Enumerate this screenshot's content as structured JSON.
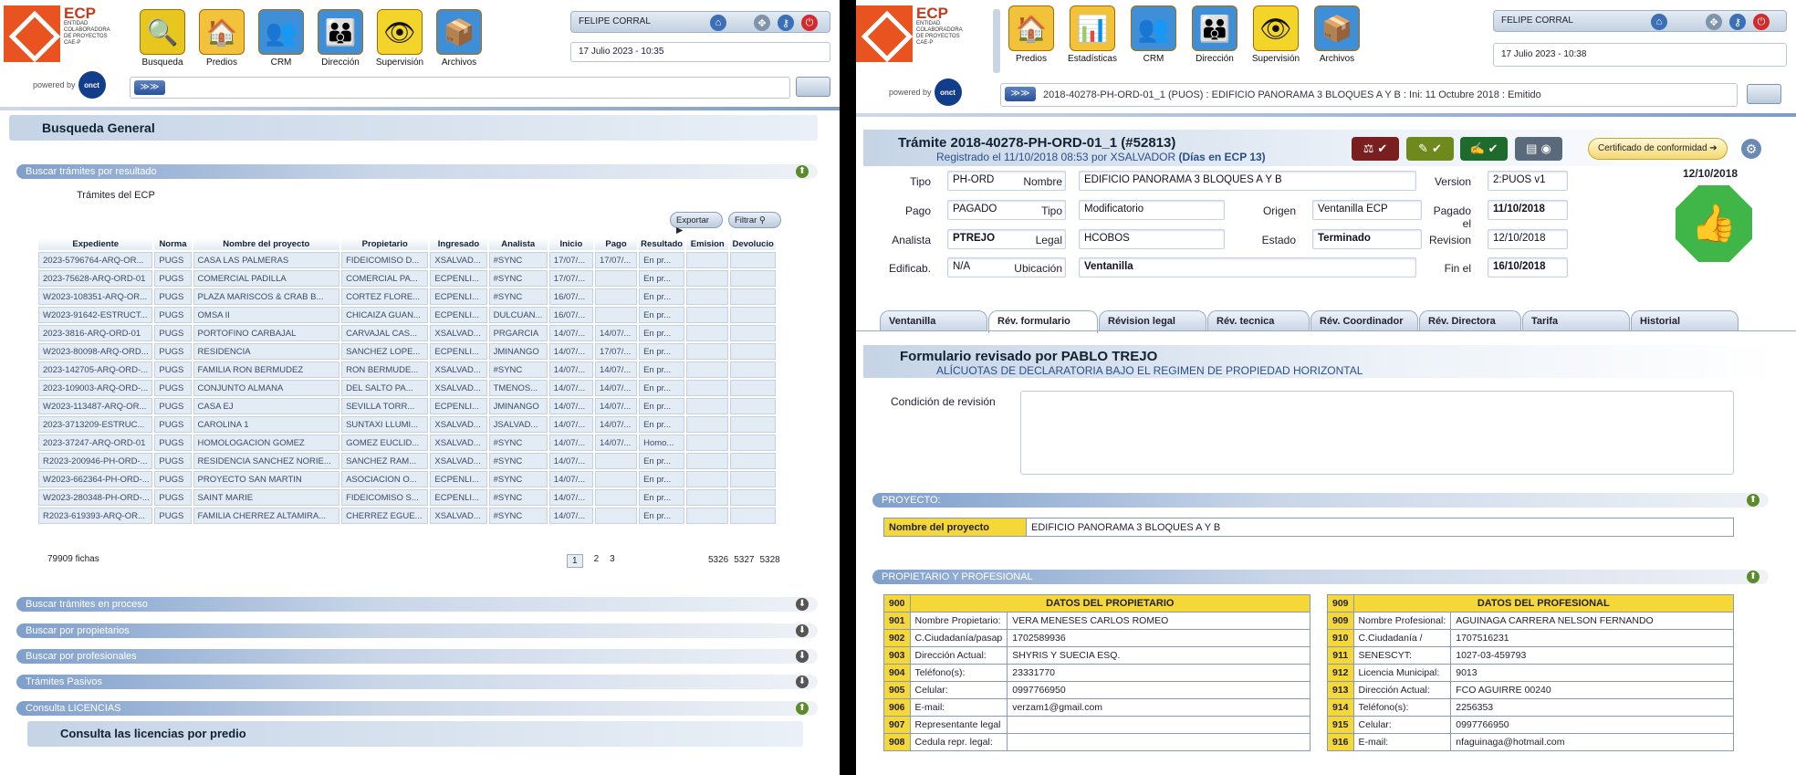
{
  "left": {
    "logo": {
      "title": "ECP",
      "sub1": "ENTIDAD",
      "sub2": "COLABORADORA",
      "sub3": "DE PROYECTOS",
      "sub4": "CAE-P",
      "powered": "powered by",
      "onct": "onct"
    },
    "nav": [
      {
        "label": "Busqueda",
        "icon": "search-icon"
      },
      {
        "label": "Predios",
        "icon": "house-icon"
      },
      {
        "label": "CRM",
        "icon": "people-icon"
      },
      {
        "label": "Dirección",
        "icon": "org-icon"
      },
      {
        "label": "Supervisión",
        "icon": "eye-icon"
      },
      {
        "label": "Archivos",
        "icon": "box-icon"
      }
    ],
    "user": "FELIPE CORRAL",
    "date": "17 Julio 2023 - 10:35",
    "crumb_arrows": "≫≫",
    "page_title": "Busqueda General",
    "sections": {
      "resultado": "Buscar trámites por resultado",
      "proceso": "Buscar trámites en proceso",
      "propietarios": "Buscar por propietarios",
      "profesionales": "Buscar por profesionales",
      "pasivos": "Trámites Pasivos",
      "licencias": "Consulta LICENCIAS"
    },
    "tramites_title": "Trámites del ECP",
    "export_label": "Exportar",
    "filter_label": "Filtrar",
    "columns": [
      "Expediente",
      "Norma",
      "Nombre del proyecto",
      "Propietario",
      "Ingresado",
      "Analista",
      "Inicio",
      "Pago",
      "Resultado",
      "Emision",
      "Devolucio"
    ],
    "rows": [
      [
        "2023-5796764-ARQ-OR...",
        "PUGS",
        "CASA LAS PALMERAS",
        "FIDEICOMISO D...",
        "XSALVAD...",
        "#SYNC",
        "17/07/...",
        "17/07/...",
        "En pr...",
        "",
        ""
      ],
      [
        "2023-75628-ARQ-ORD-01",
        "PUGS",
        "COMERCIAL PADILLA",
        "COMERCIAL PA...",
        "ECPENLI...",
        "#SYNC",
        "17/07/...",
        "",
        "En pr...",
        "",
        ""
      ],
      [
        "W2023-108351-ARQ-OR...",
        "PUGS",
        "PLAZA MARISCOS & CRAB B...",
        "CORTEZ FLORE...",
        "ECPENLI...",
        "#SYNC",
        "16/07/...",
        "",
        "En pr...",
        "",
        ""
      ],
      [
        "W2023-91642-ESTRUCT...",
        "PUGS",
        "OMSA II",
        "CHICAIZA GUAN...",
        "ECPENLI...",
        "DULCUAN...",
        "16/07/...",
        "",
        "En pr...",
        "",
        ""
      ],
      [
        "2023-3816-ARQ-ORD-01",
        "PUGS",
        "PORTOFINO CARBAJAL",
        "CARVAJAL CAS...",
        "XSALVAD...",
        "PRGARCIA",
        "14/07/...",
        "14/07/...",
        "En pr...",
        "",
        ""
      ],
      [
        "W2023-80098-ARQ-ORD...",
        "PUGS",
        "RESIDENCIA",
        "SANCHEZ LOPE...",
        "ECPENLI...",
        "JMINANGO",
        "14/07/...",
        "17/07/...",
        "En pr...",
        "",
        ""
      ],
      [
        "2023-142705-ARQ-ORD-...",
        "PUGS",
        "FAMILIA RON BERMUDEZ",
        "RON BERMUDE...",
        "XSALVAD...",
        "#SYNC",
        "14/07/...",
        "14/07/...",
        "En pr...",
        "",
        ""
      ],
      [
        "2023-109003-ARQ-ORD-...",
        "PUGS",
        "CONJUNTO ALMANA",
        "DEL SALTO PA...",
        "XSALVAD...",
        "TMENOS...",
        "14/07/...",
        "14/07/...",
        "En pr...",
        "",
        ""
      ],
      [
        "W2023-113487-ARQ-OR...",
        "PUGS",
        "CASA EJ",
        "SEVILLA TORR...",
        "ECPENLI...",
        "JMINANGO",
        "14/07/...",
        "14/07/...",
        "En pr...",
        "",
        ""
      ],
      [
        "2023-3713209-ESTRUC...",
        "PUGS",
        "CAROLINA 1",
        "SUNTAXI LLUMI...",
        "XSALVAD...",
        "JSALVAD...",
        "14/07/...",
        "14/07/...",
        "En pr...",
        "",
        ""
      ],
      [
        "2023-37247-ARQ-ORD-01",
        "PUGS",
        "HOMOLOGACION GOMEZ",
        "GOMEZ EUCLID...",
        "XSALVAD...",
        "#SYNC",
        "14/07/...",
        "14/07/...",
        "Homo...",
        "",
        ""
      ],
      [
        "R2023-200946-PH-ORD-...",
        "PUGS",
        "RESIDENCIA SANCHEZ NORIE...",
        "SANCHEZ RAM...",
        "XSALVAD...",
        "#SYNC",
        "14/07/...",
        "",
        "En pr...",
        "",
        ""
      ],
      [
        "W2023-662364-PH-ORD-...",
        "PUGS",
        "PROYECTO SAN MARTIN",
        "ASOCIACION O...",
        "ECPENLI...",
        "#SYNC",
        "14/07/...",
        "",
        "En pr...",
        "",
        ""
      ],
      [
        "W2023-280348-PH-ORD-...",
        "PUGS",
        "SAINT MARIE",
        "FIDEICOMISO S...",
        "ECPENLI...",
        "#SYNC",
        "14/07/...",
        "",
        "En pr...",
        "",
        ""
      ],
      [
        "R2023-619393-ARQ-OR...",
        "PUGS",
        "FAMILIA CHERREZ ALTAMIRA...",
        "CHERREZ EGUE...",
        "XSALVAD...",
        "#SYNC",
        "14/07/...",
        "",
        "En pr...",
        "",
        ""
      ]
    ],
    "fichas": "79909 fichas",
    "pages": [
      "1",
      "2",
      "3"
    ],
    "pages_last": [
      "5326",
      "5327",
      "5328"
    ],
    "licencias_sub": "Consulta las licencias por predio"
  },
  "right": {
    "nav": [
      {
        "label": "Predios",
        "icon": "house-icon"
      },
      {
        "label": "Estadísticas",
        "icon": "stats-icon"
      },
      {
        "label": "CRM",
        "icon": "people-icon"
      },
      {
        "label": "Dirección",
        "icon": "org-icon"
      },
      {
        "label": "Supervisión",
        "icon": "eye-icon"
      },
      {
        "label": "Archivos",
        "icon": "box-icon"
      }
    ],
    "user": "FELIPE CORRAL",
    "date": "17 Julio 2023 - 10:38",
    "crumb": "2018-40278-PH-ORD-01_1 (PUOS) : EDIFICIO PANORAMA 3 BLOQUES A Y B : Ini: 11 Octubre 2018 : Emitido",
    "tramite_title": "Trámite 2018-40278-PH-ORD-01_1 (#52813)",
    "registrado": "Registrado el 11/10/2018 08:53 por XSALVADOR",
    "dias": "(Días en ECP 13)",
    "cert_label": "Certificado de conformidad",
    "fields": {
      "tipo_l": "Tipo",
      "tipo": "PH-ORD",
      "nombre_l": "Nombre",
      "nombre": "EDIFICIO PANORAMA 3 BLOQUES A Y B",
      "version_l": "Version",
      "version": "2:PUOS v1",
      "pago_l": "Pago",
      "pago": "PAGADO",
      "tipo2_l": "Tipo",
      "tipo2": "Modificatorio",
      "origen_l": "Origen",
      "origen": "Ventanilla ECP",
      "pagadoel_l": "Pagado el",
      "pagadoel": "11/10/2018",
      "analista_l": "Analista",
      "analista": "PTREJO",
      "legal_l": "Legal",
      "legal": "HCOBOS",
      "estado_l": "Estado",
      "estado": "Terminado",
      "revision_l": "Revision",
      "revision": "12/10/2018",
      "edificab_l": "Edificab.",
      "edificab": "N/A",
      "ubicacion_l": "Ubicación",
      "ubicacion": "Ventanilla",
      "finel_l": "Fin el",
      "finel": "16/10/2018"
    },
    "emission_date": "12/10/2018",
    "tabs": [
      "Ventanilla",
      "Rév. formulario",
      "Révision legal",
      "Rév. tecnica",
      "Rév. Coordinador",
      "Rév. Directora",
      "Tarifa",
      "Historial"
    ],
    "form_title": "Formulario revisado por PABLO TREJO",
    "form_sub": "ALÍCUOTAS DE DECLARATORIA BAJO EL REGIMEN DE PROPIEDAD HORIZONTAL",
    "condicion_label": "Condición de revisión",
    "proyecto_sect": "PROYECTO:",
    "nombre_proyecto_label": "Nombre del proyecto",
    "nombre_proyecto": "EDIFICIO PANORAMA 3 BLOQUES A Y B",
    "prop_sect": "PROPIETARIO Y PROFESIONAL",
    "owner": {
      "num": "900",
      "title": "DATOS DEL PROPIETARIO",
      "rows": [
        [
          "901",
          "Nombre Propietario:",
          "VERA MENESES CARLOS ROMEO"
        ],
        [
          "902",
          "C.Ciudadanía/pasap",
          "1702589936"
        ],
        [
          "903",
          "Dirección Actual:",
          "SHYRIS Y SUECIA ESQ."
        ],
        [
          "904",
          "Teléfono(s):",
          "23331770"
        ],
        [
          "905",
          "Celular:",
          "0997766950"
        ],
        [
          "906",
          "E-mail:",
          "verzam1@gmail.com"
        ],
        [
          "907",
          "Representante legal",
          ""
        ],
        [
          "908",
          "Cedula repr. legal:",
          ""
        ]
      ]
    },
    "prof": {
      "num": "909",
      "title": "DATOS DEL PROFESIONAL",
      "rows": [
        [
          "909",
          "Nombre Profesional:",
          "AGUINAGA CARRERA NELSON FERNANDO"
        ],
        [
          "910",
          "C.Ciudadanía /",
          "1707516231"
        ],
        [
          "911",
          "SENESCYT:",
          "1027-03-459793"
        ],
        [
          "912",
          "Licencia Municipal:",
          "9013"
        ],
        [
          "913",
          "Dirección Actual:",
          "FCO AGUIRRE 00240"
        ],
        [
          "914",
          "Teléfono(s):",
          "2256353"
        ],
        [
          "915",
          "Celular:",
          "0997766950"
        ],
        [
          "916",
          "E-mail:",
          "nfaguinaga@hotmail.com"
        ]
      ]
    }
  }
}
